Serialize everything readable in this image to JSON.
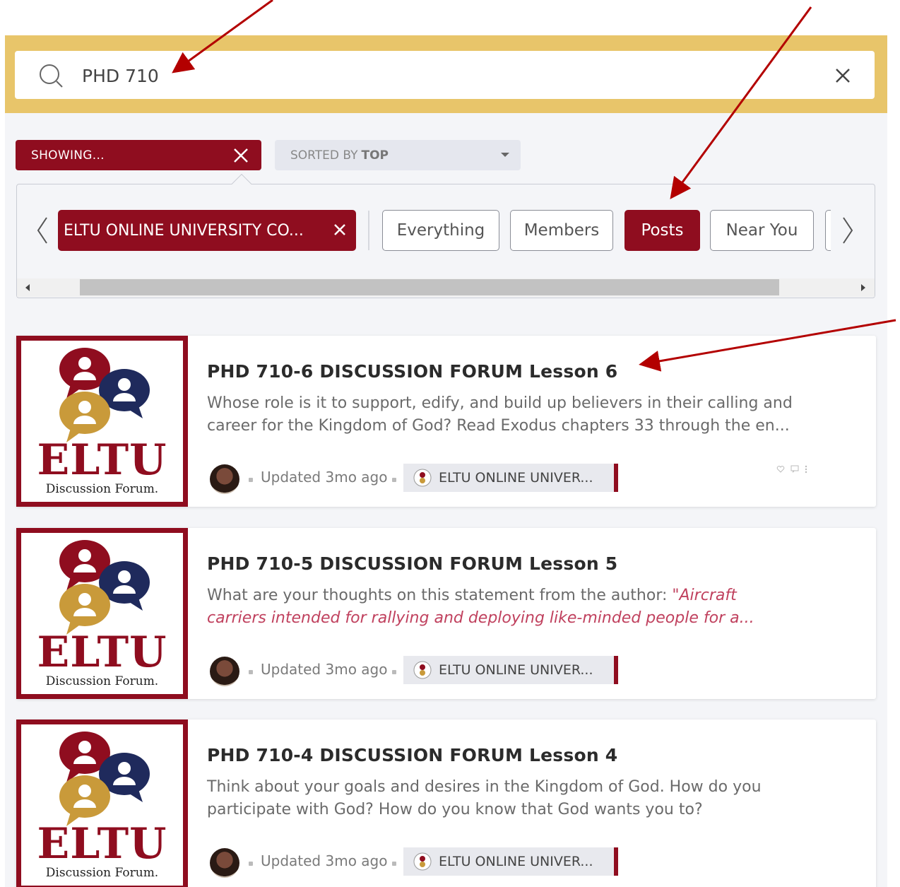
{
  "search": {
    "value": "PHD 710"
  },
  "filters": {
    "showing_label": "SHOWING...",
    "sort_prefix": "SORTED BY",
    "sort_value": "TOP",
    "scope_chip": "ELTU ONLINE UNIVERSITY CO...",
    "chips": [
      "Everything",
      "Members",
      "Posts",
      "Near You"
    ],
    "active_chip": "Posts"
  },
  "thumbnail": {
    "brand": "ELTU",
    "caption": "Discussion Forum."
  },
  "posts": [
    {
      "title": "PHD 710-6 DISCUSSION FORUM Lesson 6",
      "excerpt": "Whose role is it to support, edify, and build up believers in their calling and career for the Kingdom of God? Read Exodus chapters 33 through the en...",
      "excerpt_quote": "",
      "updated": "Updated 3mo ago",
      "group": "ELTU ONLINE UNIVER..."
    },
    {
      "title": "PHD 710-5 DISCUSSION FORUM Lesson 5",
      "excerpt": "What are your thoughts on this statement from the author: ",
      "excerpt_quote": "\"Aircraft carriers intended for rallying and deploying like-minded people for a...",
      "updated": "Updated 3mo ago",
      "group": "ELTU ONLINE UNIVER..."
    },
    {
      "title": "PHD 710-4 DISCUSSION FORUM Lesson 4",
      "excerpt": "Think about your goals and desires in the Kingdom of God. How do you participate with God? How do you know that God wants you to?",
      "excerpt_quote": "",
      "updated": "Updated 3mo ago",
      "group": "ELTU ONLINE UNIVER..."
    }
  ],
  "colors": {
    "brand": "#8f0d1f",
    "search_band": "#e8c56a",
    "navy": "#1f2a5c",
    "gold": "#c99a3a"
  }
}
